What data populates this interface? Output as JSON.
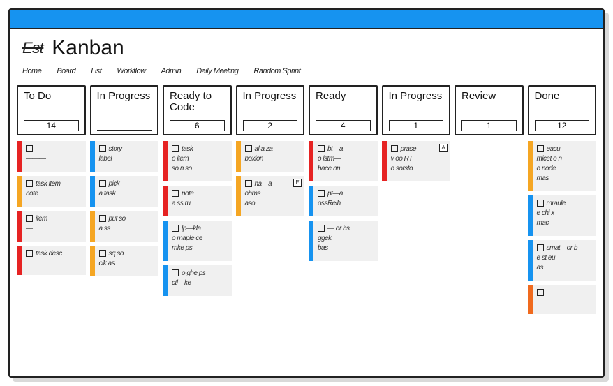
{
  "header": {
    "logo_text": "Est",
    "title": "Kanban",
    "menu": [
      "Home",
      "Board",
      "List",
      "Workflow",
      "Admin",
      "Daily Meeting",
      "Random Sprint"
    ]
  },
  "columns": [
    {
      "title": "To Do",
      "count": "14",
      "cards": [
        {
          "stripe": "red",
          "lines": [
            "———",
            "———"
          ]
        },
        {
          "stripe": "orange",
          "lines": [
            "task item",
            "note"
          ]
        },
        {
          "stripe": "red",
          "lines": [
            "item",
            "—"
          ]
        },
        {
          "stripe": "red",
          "lines": [
            "task desc"
          ]
        }
      ]
    },
    {
      "title": "In Progress",
      "count": "",
      "cards": [
        {
          "stripe": "blue",
          "lines": [
            "story",
            "label"
          ]
        },
        {
          "stripe": "blue",
          "lines": [
            "pick",
            "a task"
          ]
        },
        {
          "stripe": "orange",
          "lines": [
            "put so",
            "a ss"
          ]
        },
        {
          "stripe": "orange",
          "lines": [
            "sq so",
            "clk as"
          ]
        }
      ]
    },
    {
      "title": "Ready to Code",
      "count": "6",
      "cards": [
        {
          "stripe": "red",
          "lines": [
            "task",
            "o item",
            "so n so"
          ]
        },
        {
          "stripe": "red",
          "lines": [
            "note",
            "a ss ru"
          ]
        },
        {
          "stripe": "blue",
          "lines": [
            "lp—kla",
            "o maple ce",
            "mke ps"
          ]
        },
        {
          "stripe": "blue",
          "lines": [
            "o ghe ps",
            "ctl—ke"
          ]
        }
      ]
    },
    {
      "title": "In Progress",
      "count": "2",
      "cards": [
        {
          "stripe": "orange",
          "lines": [
            "al a za",
            "boxlon"
          ]
        },
        {
          "stripe": "orange",
          "lines": [
            "ha—a",
            "ohms",
            "aso"
          ],
          "badge": "E"
        }
      ]
    },
    {
      "title": "Ready",
      "count": "4",
      "cards": [
        {
          "stripe": "red",
          "lines": [
            "bt—a",
            "o lstm—",
            "hace nn"
          ]
        },
        {
          "stripe": "blue",
          "lines": [
            "pt—a",
            "ossRelh"
          ]
        },
        {
          "stripe": "blue",
          "lines": [
            "— or bs",
            "ggek",
            "bas"
          ]
        }
      ]
    },
    {
      "title": "In Progress",
      "count": "1",
      "cards": [
        {
          "stripe": "red",
          "lines": [
            "prase",
            "v oo RT",
            "o sorsto"
          ],
          "badge": "A"
        }
      ]
    },
    {
      "title": "Review",
      "count": "1",
      "cards": []
    },
    {
      "title": "Done",
      "count": "12",
      "cards": [
        {
          "stripe": "orange",
          "lines": [
            "eacu",
            "micet o n",
            "o node",
            "mas"
          ]
        },
        {
          "stripe": "blue",
          "lines": [
            "mraule",
            "e chi x",
            "mac"
          ]
        },
        {
          "stripe": "blue",
          "lines": [
            "smat—or b",
            "e st eu",
            "as"
          ]
        },
        {
          "stripe": "dorange",
          "lines": [
            ""
          ]
        }
      ]
    }
  ]
}
